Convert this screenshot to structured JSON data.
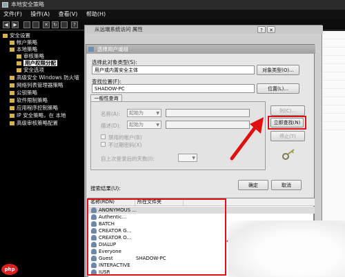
{
  "window": {
    "title": "本地安全策略"
  },
  "menu": {
    "items": [
      "文件(F)",
      "操作(A)",
      "查看(V)",
      "帮助(H)"
    ]
  },
  "tree": {
    "items": [
      {
        "label": "安全设置",
        "selected": false
      },
      {
        "label": "帐户策略",
        "selected": false
      },
      {
        "label": "本地策略",
        "selected": false
      },
      {
        "label": "审核策略",
        "selected": false
      },
      {
        "label": "用户权限分配",
        "selected": true
      },
      {
        "label": "安全选项",
        "selected": false
      },
      {
        "label": "高级安全 Windows 防火墙",
        "selected": false
      },
      {
        "label": "网络列表管理器策略",
        "selected": false
      },
      {
        "label": "公钥策略",
        "selected": false
      },
      {
        "label": "软件限制策略",
        "selected": false
      },
      {
        "label": "应用程序控制策略",
        "selected": false
      },
      {
        "label": "IP 安全策略，在 本地",
        "selected": false
      },
      {
        "label": "高级审核策略配置",
        "selected": false
      }
    ]
  },
  "prop_dialog": {
    "title": "从远端系统访问 属性"
  },
  "dialog": {
    "title": "选择用户或组",
    "object_type_label": "选择此对象类型(S):",
    "object_type_value": "用户或内置安全主体",
    "object_type_button": "对象类型(O)...",
    "location_label": "查找位置(F):",
    "location_value": "SHADOW-PC",
    "location_button": "位置(L)...",
    "tab": "一般性查询",
    "name_label": "名称(A):",
    "desc_label": "描述(D):",
    "starts_with": "起始为",
    "disabled_accounts": "禁用的帐户(B)",
    "non_expiring": "不过期密码(X)",
    "days_label": "自上次登录后的天数(I):",
    "columns_button": "列(C)...",
    "find_now_button": "立即查找(N)",
    "stop_button": "停止(T)",
    "ok_button": "确定",
    "cancel_button": "取消",
    "results_label": "搜索结果(U):",
    "results_columns": [
      "名称(RDN)",
      "所在文件夹"
    ],
    "results": [
      {
        "name": "ANONYMOUS ...",
        "folder": ""
      },
      {
        "name": "Authentic...",
        "folder": ""
      },
      {
        "name": "BATCH",
        "folder": ""
      },
      {
        "name": "CREATOR G...",
        "folder": ""
      },
      {
        "name": "CREATOR O...",
        "folder": ""
      },
      {
        "name": "DIALUP",
        "folder": ""
      },
      {
        "name": "Everyone",
        "folder": ""
      },
      {
        "name": "Guest",
        "folder": "SHADOW-PC"
      },
      {
        "name": "INTERACTIVE",
        "folder": ""
      },
      {
        "name": "IUSR",
        "folder": ""
      }
    ]
  },
  "watermark": {
    "text": "php"
  },
  "colors": {
    "highlight": "#e01010",
    "tree_bg": "#000000",
    "dialog_bg": "#e6e6e6"
  }
}
